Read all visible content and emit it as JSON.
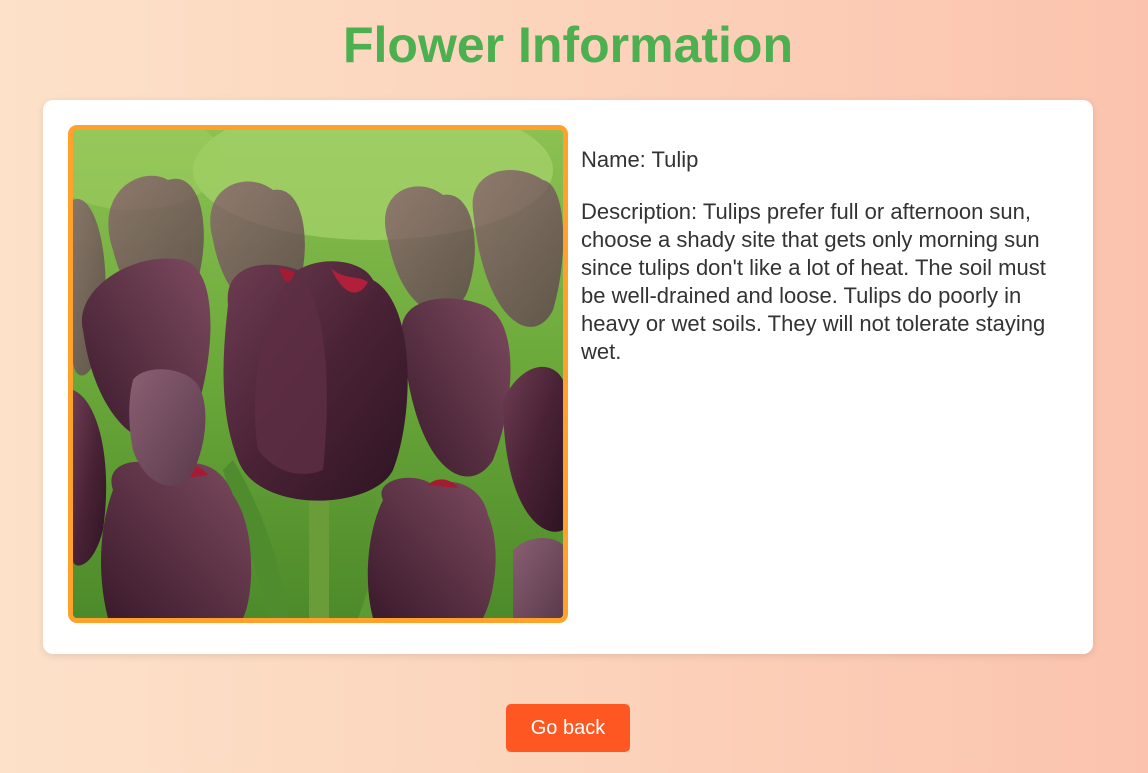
{
  "page": {
    "title": "Flower Information"
  },
  "flower": {
    "name_line": "Name: Tulip",
    "description_line": "Description: Tulips prefer full or afternoon sun, choose a shady site that gets only morning sun since tulips don't like a lot of heat. The soil must be well-drained and loose. Tulips do poorly in heavy or wet soils. They will not tolerate staying wet.",
    "image_alt": "tulip-photo"
  },
  "actions": {
    "back_label": "Go back"
  },
  "colors": {
    "title": "#4caf50",
    "image_border": "#ffa12b",
    "button": "#ff5722",
    "text": "#333333"
  }
}
